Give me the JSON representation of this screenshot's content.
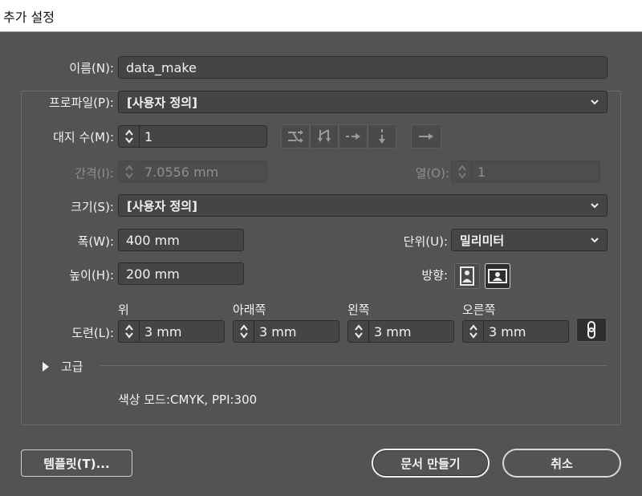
{
  "window": {
    "title": "추가 설정"
  },
  "name": {
    "label": "이름(N):",
    "value": "data_make"
  },
  "profile": {
    "label": "프로파일(P):",
    "value": "[사용자 정의]"
  },
  "artboards": {
    "label": "대지 수(M):",
    "value": "1",
    "layout_icons": [
      "grid-by-row-icon",
      "grid-by-column-icon",
      "arrange-by-row-icon",
      "arrange-by-column-icon",
      "right-to-left-icon"
    ]
  },
  "spacing": {
    "label": "간격(I):",
    "value": "7.0556 mm",
    "enabled": false
  },
  "columns": {
    "label": "열(O):",
    "value": "1",
    "enabled": false
  },
  "size": {
    "label": "크기(S):",
    "value": "[사용자 정의]"
  },
  "width": {
    "label": "폭(W):",
    "value": "400 mm"
  },
  "units": {
    "label": "단위(U):",
    "value": "밀리미터"
  },
  "height": {
    "label": "높이(H):",
    "value": "200 mm"
  },
  "orientation": {
    "label": "방향:",
    "selected": "landscape"
  },
  "bleed": {
    "label": "도련(L):",
    "top": {
      "header": "위",
      "value": "3 mm"
    },
    "bottom": {
      "header": "아래쪽",
      "value": "3 mm"
    },
    "left": {
      "header": "왼쪽",
      "value": "3 mm"
    },
    "right": {
      "header": "오른쪽",
      "value": "3 mm"
    },
    "link_icon": "chain-link-icon"
  },
  "advanced": {
    "label": "고급"
  },
  "color_info": "색상 모드:CMYK, PPI:300",
  "buttons": {
    "templates": "템플릿(T)...",
    "create": "문서 만들기",
    "cancel": "취소"
  },
  "colors": {
    "background": "#535353",
    "field": "#454545",
    "title_bar": "#ffffff"
  }
}
